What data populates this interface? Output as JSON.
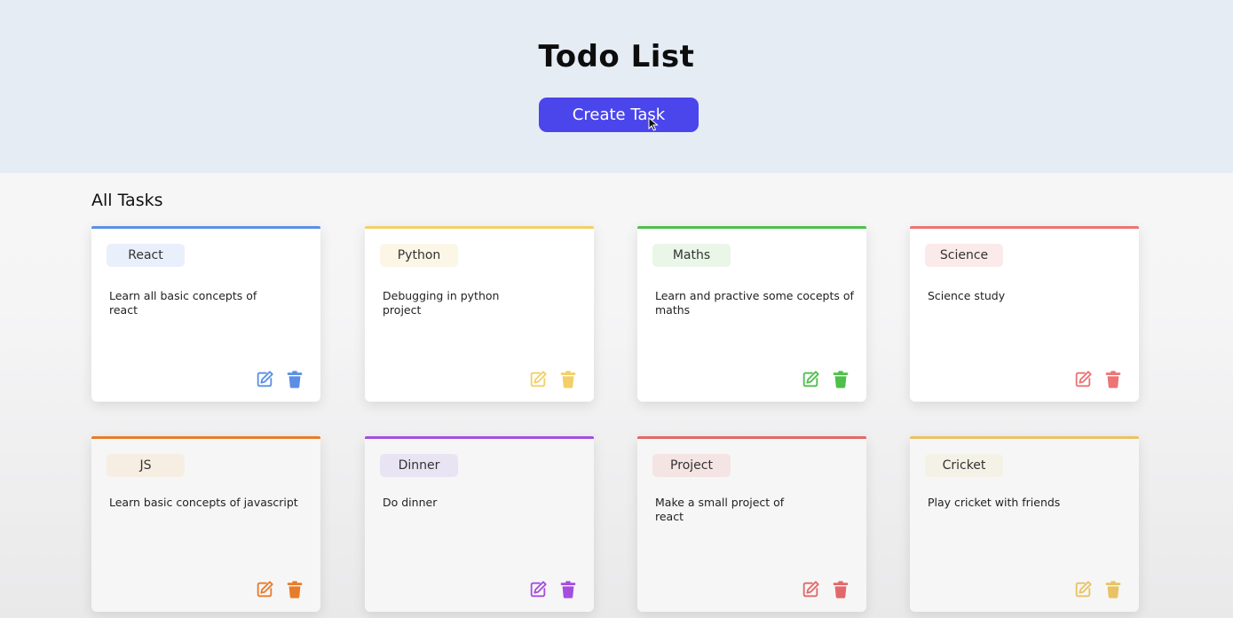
{
  "header": {
    "title": "Todo List",
    "create_button_label": "Create Task"
  },
  "section_title": "All Tasks",
  "tasks": [
    {
      "tag": "React",
      "description": "Learn all basic concepts of react",
      "color": "#5b8fe6",
      "tag_bg": "#e9effb"
    },
    {
      "tag": "Python",
      "description": "Debugging in python project",
      "color": "#f2cf68",
      "tag_bg": "#fbf6e6"
    },
    {
      "tag": "Maths",
      "description": "Learn and practive some cocepts of maths",
      "color": "#4ec04a",
      "tag_bg": "#e9f6e8"
    },
    {
      "tag": "Science",
      "description": "Science study",
      "color": "#ec7474",
      "tag_bg": "#fbeaea"
    },
    {
      "tag": "JS",
      "description": "Learn basic concepts of javascript",
      "color": "#e87c2b",
      "tag_bg": "#f6eee2"
    },
    {
      "tag": "Dinner",
      "description": "Do dinner",
      "color": "#a44ee0",
      "tag_bg": "#e9e4f3"
    },
    {
      "tag": "Project",
      "description": "Make a small project of react",
      "color": "#e2686a",
      "tag_bg": "#f5e4e4"
    },
    {
      "tag": "Cricket",
      "description": "Play cricket with friends",
      "color": "#e9c265",
      "tag_bg": "#f4f1e6"
    }
  ],
  "icons": {
    "edit": "edit-icon",
    "delete": "trash-icon",
    "cursor": "mouse-cursor-icon"
  }
}
